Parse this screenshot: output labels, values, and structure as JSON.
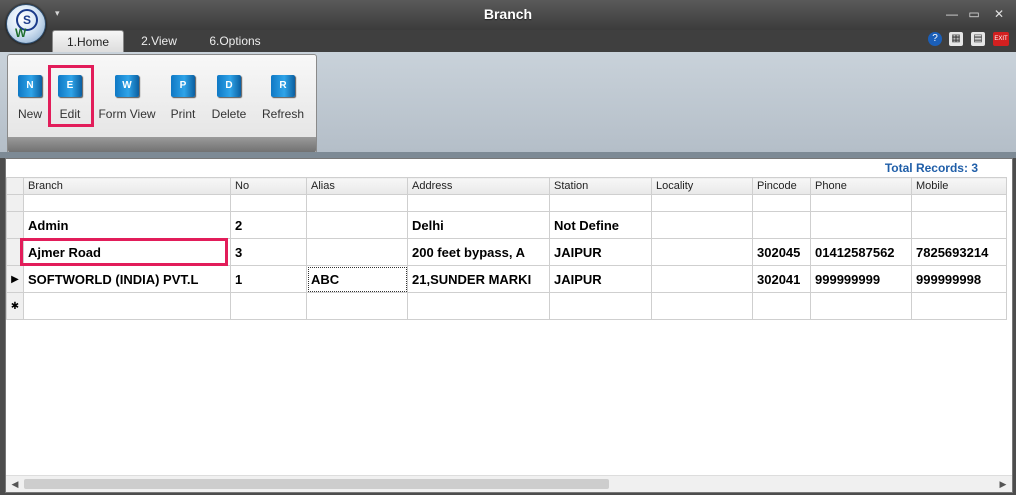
{
  "window": {
    "title": "Branch",
    "qat_glyph": "▾",
    "minimize_glyph": "—",
    "restore_glyph": "▭",
    "close_glyph": "✕"
  },
  "app_logo": {
    "top": "S",
    "bottom": "W"
  },
  "tabs": [
    {
      "label": "1.Home",
      "active": true
    },
    {
      "label": "2.View",
      "active": false
    },
    {
      "label": "6.Options",
      "active": false
    }
  ],
  "header_icons": [
    {
      "name": "help-icon",
      "glyph": "?"
    },
    {
      "name": "calculator-icon",
      "glyph": "▦"
    },
    {
      "name": "report-icon",
      "glyph": "▤"
    },
    {
      "name": "exit-icon",
      "glyph": "EXIT"
    }
  ],
  "ribbon": {
    "buttons": [
      {
        "label": "New",
        "icon_letter": "N"
      },
      {
        "label": "Edit",
        "icon_letter": "E"
      },
      {
        "label": "Form View",
        "icon_letter": "W"
      },
      {
        "label": "Print",
        "icon_letter": "P"
      },
      {
        "label": "Delete",
        "icon_letter": "D"
      },
      {
        "label": "Refresh",
        "icon_letter": "R"
      }
    ]
  },
  "grid": {
    "total_records": "Total Records: 3",
    "columns": [
      "Branch",
      "No",
      "Alias",
      "Address",
      "Station",
      "Locality",
      "Pincode",
      "Phone",
      "Mobile"
    ],
    "rows": [
      {
        "indicator": "",
        "cells": [
          "Admin",
          "2",
          "",
          "Delhi",
          "Not Define",
          "",
          "",
          "",
          ""
        ]
      },
      {
        "indicator": "",
        "cells": [
          "Ajmer Road",
          "3",
          "",
          "200 feet bypass, A",
          "JAIPUR",
          "",
          "302045",
          "01412587562",
          "7825693214"
        ]
      },
      {
        "indicator": "▶",
        "cells": [
          "SOFTWORLD (INDIA) PVT.L",
          "1",
          "ABC",
          "21,SUNDER MARKI",
          "JAIPUR",
          "",
          "302041",
          "999999999",
          "999999998"
        ]
      },
      {
        "indicator": "✱",
        "cells": [
          "",
          "",
          "",
          "",
          "",
          "",
          "",
          "",
          ""
        ]
      }
    ],
    "scroll_left": "◀",
    "scroll_right": "▶"
  },
  "colors": {
    "accent": "#1f5ea8",
    "highlight": "#e21d5a"
  }
}
